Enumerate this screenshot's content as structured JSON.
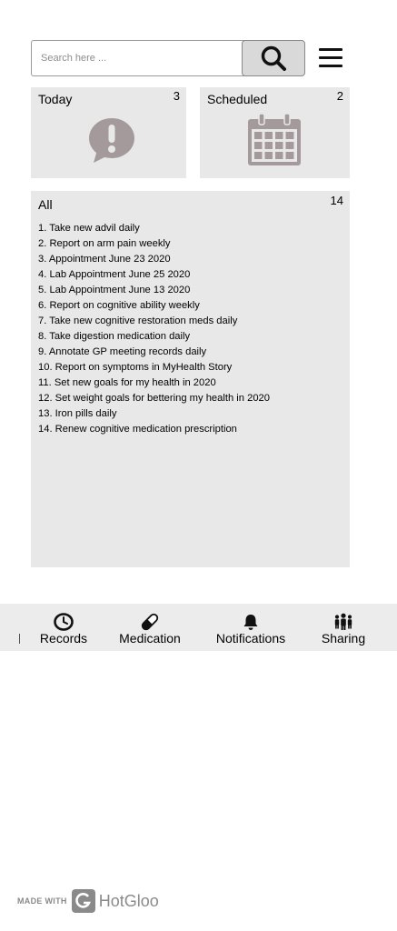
{
  "search": {
    "placeholder": "Search here ..."
  },
  "icons": {
    "search": "search-icon",
    "menu": "hamburger-menu-icon",
    "today": "exclamation-speech-bubble-icon",
    "scheduled": "calendar-icon",
    "records": "clock-icon",
    "medication": "pill-icon",
    "notifications": "bell-icon",
    "sharing": "people-group-icon"
  },
  "cards": {
    "today": {
      "title": "Today",
      "count": "3"
    },
    "scheduled": {
      "title": "Scheduled",
      "count": "2"
    },
    "all": {
      "title": "All",
      "count": "14",
      "items": [
        "1. Take new advil daily",
        "2. Report on arm pain weekly",
        "3. Appointment June 23 2020",
        "4. Lab Appointment June 25 2020",
        "5. Lab Appointment June 13 2020",
        "6. Report on cognitive ability weekly",
        "7. Take new cognitive restoration meds daily",
        "8. Take digestion medication daily",
        "9. Annotate GP meeting records daily",
        "10. Report on symptoms in MyHealth Story",
        "11. Set new goals for my health in 2020",
        "12. Set weight goals for bettering my health in 2020",
        "13. Iron pills daily",
        "14. Renew cognitive medication prescription"
      ]
    }
  },
  "tabs": {
    "records": "Records",
    "medication": "Medication",
    "notifications": "Notifications",
    "sharing": "Sharing"
  },
  "watermark": {
    "prefix": "MADE WITH",
    "brand": "HotGloo"
  },
  "colors": {
    "card_bg": "#e8e8e8",
    "icon_gray": "#a49a9c",
    "tabbar_bg": "#ececec"
  }
}
